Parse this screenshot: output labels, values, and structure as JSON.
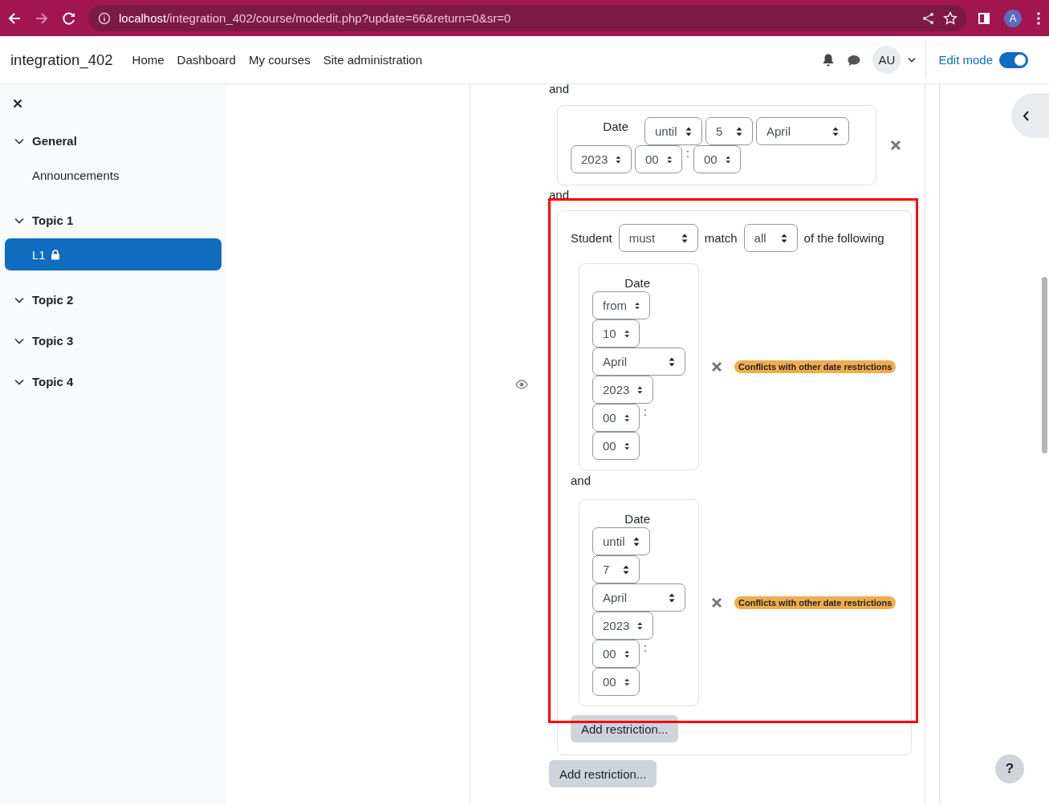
{
  "browser": {
    "url_host": "localhost",
    "url_path": "/integration_402/course/modedit.php?update=66&return=0&sr=0",
    "profile_initial": "A"
  },
  "navbar": {
    "site_name": "integration_402",
    "links": [
      {
        "label": "Home"
      },
      {
        "label": "Dashboard"
      },
      {
        "label": "My courses"
      },
      {
        "label": "Site administration"
      }
    ],
    "avatar": "AU",
    "edit_mode": {
      "label": "Edit mode",
      "on": true
    }
  },
  "sidebar": {
    "sections": [
      {
        "label": "General",
        "children": [
          {
            "label": "Announcements",
            "selected": false,
            "locked": false
          }
        ]
      },
      {
        "label": "Topic 1",
        "children": [
          {
            "label": "L1",
            "selected": true,
            "locked": true
          }
        ]
      },
      {
        "label": "Topic 2"
      },
      {
        "label": "Topic 3"
      },
      {
        "label": "Topic 4"
      }
    ]
  },
  "restrictions": {
    "items": [
      {
        "kind": "connector",
        "text": "and"
      },
      {
        "kind": "date",
        "label": "Date",
        "fields": [
          {
            "kind": "direction",
            "value": "until"
          },
          {
            "kind": "day",
            "value": "5"
          },
          {
            "kind": "month",
            "value": "April"
          },
          {
            "kind": "year",
            "value": "2023"
          },
          {
            "kind": "hour",
            "value": "00"
          },
          {
            "kind": "minute",
            "value": "00"
          }
        ],
        "time_separator": ":"
      },
      {
        "kind": "connector",
        "text": "and"
      },
      {
        "kind": "group",
        "highlighted": true,
        "student_label": "Student",
        "mode": "must",
        "match_label": "match",
        "scope": "all",
        "suffix": "of the following",
        "items": [
          {
            "kind": "date",
            "label": "Date",
            "fields": [
              {
                "kind": "direction",
                "value": "from"
              },
              {
                "kind": "day",
                "value": "10"
              },
              {
                "kind": "month",
                "value": "April"
              },
              {
                "kind": "year",
                "value": "2023"
              },
              {
                "kind": "hour",
                "value": "00"
              },
              {
                "kind": "minute",
                "value": "00"
              }
            ],
            "time_separator": ":",
            "warning": "Conflicts with other date restrictions"
          },
          {
            "kind": "connector",
            "text": "and"
          },
          {
            "kind": "date",
            "label": "Date",
            "fields": [
              {
                "kind": "direction",
                "value": "until"
              },
              {
                "kind": "day",
                "value": "7"
              },
              {
                "kind": "month",
                "value": "April"
              },
              {
                "kind": "year",
                "value": "2023"
              },
              {
                "kind": "hour",
                "value": "00"
              },
              {
                "kind": "minute",
                "value": "00"
              }
            ],
            "time_separator": ":",
            "warning": "Conflicts with other date restrictions"
          }
        ],
        "add_button": "Add restriction..."
      }
    ],
    "add_button": "Add restriction..."
  },
  "help_button": "?"
}
